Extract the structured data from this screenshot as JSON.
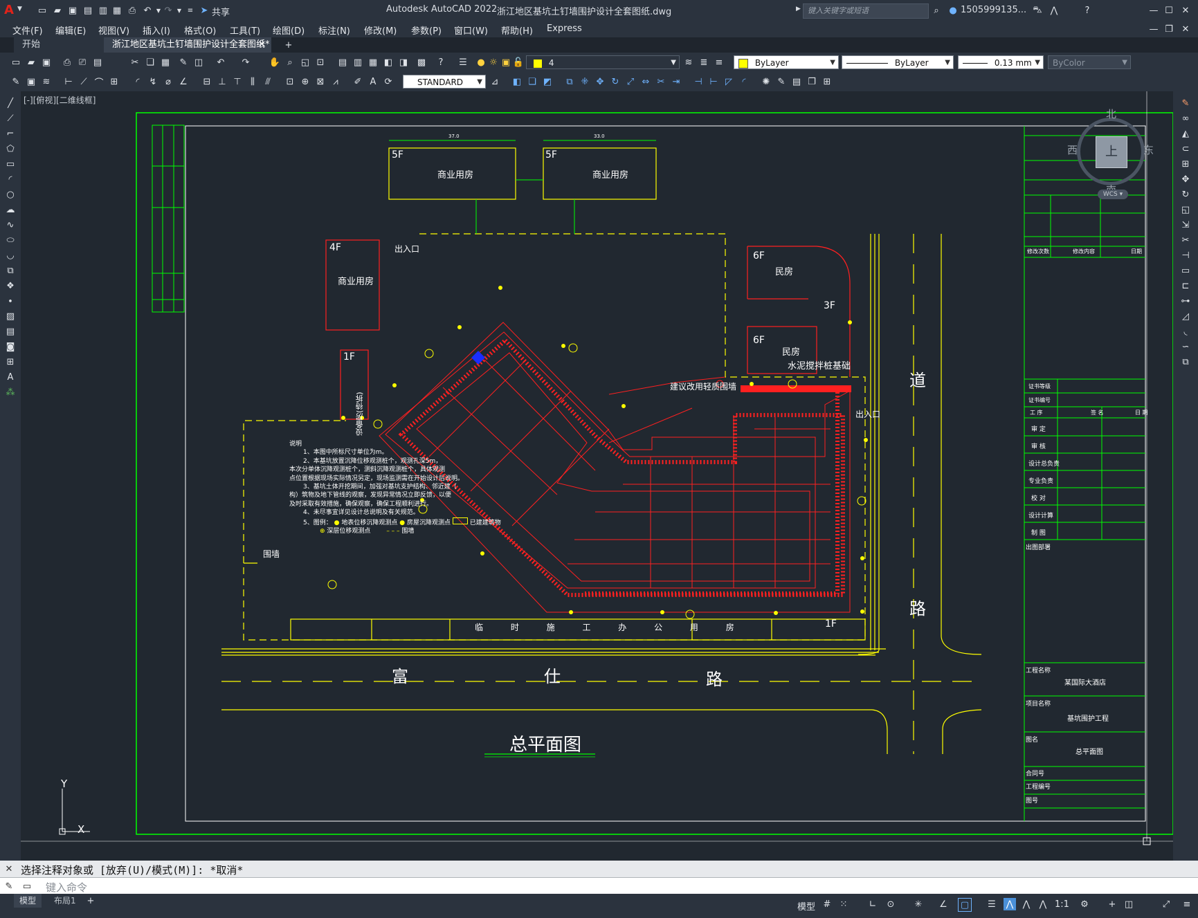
{
  "window": {
    "app_title": "Autodesk AutoCAD 2022",
    "file_title": "浙江地区基坑土钉墙围护设计全套图纸.dwg",
    "search_placeholder": "键入关键字或短语",
    "user": "1505999135...",
    "share_label": "共享"
  },
  "menu": [
    "文件(F)",
    "编辑(E)",
    "视图(V)",
    "插入(I)",
    "格式(O)",
    "工具(T)",
    "绘图(D)",
    "标注(N)",
    "修改(M)",
    "参数(P)",
    "窗口(W)",
    "帮助(H)",
    "Express"
  ],
  "tabs": [
    {
      "label": "开始"
    },
    {
      "label": "浙江地区基坑土钉墙围护设计全套图纸*"
    }
  ],
  "properties": {
    "layer_value": "4",
    "text_style": "STANDARD",
    "color": "ByLayer",
    "linetype": "ByLayer",
    "lineweight": "0.13 mm",
    "plotstyle": "ByColor",
    "layer_color": "#ffff00"
  },
  "viewport": {
    "label": "[-][俯视][二维线框]",
    "viewcube": {
      "north": "北",
      "south": "南",
      "east": "东",
      "west": "西",
      "top": "上",
      "wcs": "WCS"
    }
  },
  "drawing": {
    "title": "总平面图",
    "roads": {
      "left_1": "富",
      "left_2": "仕",
      "left_3": "路",
      "right_1": "道",
      "right_2": "路"
    },
    "buildings": [
      {
        "floors": "5F",
        "name": "商业用房"
      },
      {
        "floors": "5F",
        "name": "商业用房"
      },
      {
        "floors": "4F",
        "name": "商业用房"
      },
      {
        "floors": "1F",
        "name": "设备房(待拆)"
      },
      {
        "floors": "6F",
        "name": "民房"
      },
      {
        "floors": "3F",
        "name": ""
      },
      {
        "floors": "6F",
        "name": "民房"
      },
      {
        "floors": "1F",
        "name": ""
      }
    ],
    "labels": {
      "entrance_1": "出入口",
      "entrance_2": "出入口",
      "wall_note": "水泥搅拌桩基础",
      "wall_note_2": "建议改用轻质围墙",
      "fence": "围墙",
      "temp": "临 时 施 工 办 公 用 房",
      "dim_1": "37.0",
      "dim_2": "33.0"
    },
    "notes": {
      "heading": "说明",
      "lines": [
        "1、本图中所标尺寸单位为m。",
        "2、本基坑放置沉降位移观测桩个，观测孔深5m，",
        "本次分单体沉降观测桩个，测斜沉降观测桩个，具体观测",
        "点位置根据现场实际情况另定，现场监测需在开始设计后说明。",
        "3、基坑土体开挖期间，加强对基坑支护结构、邻近建（",
        "构）筑物及地下管线的观察，发现异常情况立即反馈，以便",
        "及时采取有效措施，确保观察，确保工程顺利进行。",
        "4、未尽事宜详见设计总说明及有关规范。",
        "5、图例：",
        "地表位移沉降观测点",
        "房屋沉降观测点",
        "已建建筑物",
        "深层位移观测点",
        "围墙"
      ]
    },
    "title_block": {
      "rows_top": [
        "修改次数",
        "修改内容",
        "日期"
      ],
      "rows": [
        "证书等级",
        "证书编号",
        "工 序",
        "签 名",
        "日 期",
        "审 定",
        "审 核",
        "设计总负责",
        "专业负责",
        "校 对",
        "设计计算",
        "制 图",
        "出图部署"
      ],
      "project_label": "工程名称",
      "project_value": "某国际大酒店",
      "item_label": "项目名称",
      "item_value": "基坑围护工程",
      "drawing_label": "图名",
      "drawing_value": "总平面图",
      "contract_label": "合同号",
      "job_label": "工程编号",
      "sheet_label": "图号"
    }
  },
  "command": {
    "history": "选择注释对象或 [放弃(U)/模式(M)]: *取消*",
    "placeholder": "键入命令"
  },
  "status": {
    "layout_tabs": [
      "模型",
      "布局1"
    ],
    "model_label": "模型",
    "scale": "1:1"
  }
}
